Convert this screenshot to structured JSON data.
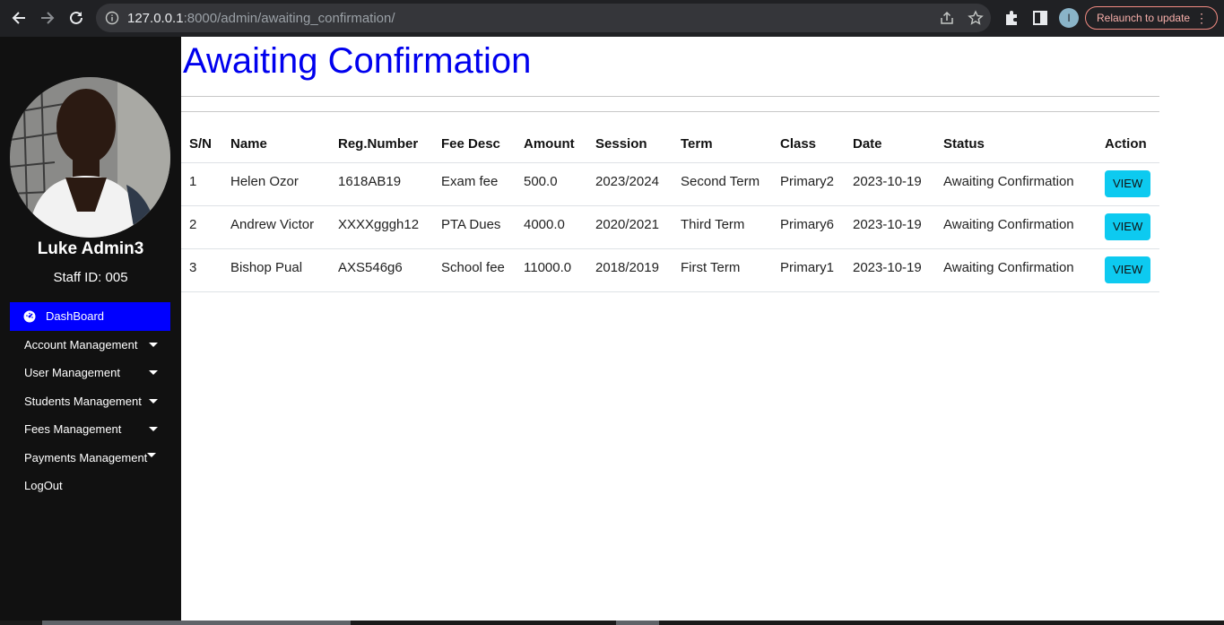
{
  "browser": {
    "url_host": "127.0.0.1",
    "url_rest": ":8000/admin/awaiting_confirmation/",
    "profile_initial": "I",
    "relaunch_label": "Relaunch to update"
  },
  "sidebar": {
    "user_name": "Luke Admin3",
    "staff_id": "Staff ID: 005",
    "items": [
      {
        "label": "DashBoard",
        "active": true
      },
      {
        "label": "Account Management",
        "has_caret": true
      },
      {
        "label": "User Management",
        "has_caret": true
      },
      {
        "label": "Students Management",
        "has_caret": true
      },
      {
        "label": "Fees Management",
        "has_caret": true
      },
      {
        "label": "Payments Management",
        "has_caret": true
      },
      {
        "label": "LogOut"
      }
    ]
  },
  "main": {
    "title": "Awaiting Confirmation",
    "columns": [
      "S/N",
      "Name",
      "Reg.Number",
      "Fee Desc",
      "Amount",
      "Session",
      "Term",
      "Class",
      "Date",
      "Status",
      "Action"
    ],
    "rows": [
      {
        "sn": "1",
        "name": "Helen Ozor",
        "reg": "1618AB19",
        "fee": "Exam fee",
        "amount": "500.0",
        "session": "2023/2024",
        "term": "Second Term",
        "class": "Primary2",
        "date": "2023-10-19",
        "status": "Awaiting Confirmation",
        "action": "VIEW"
      },
      {
        "sn": "2",
        "name": "Andrew Victor",
        "reg": "XXXXgggh12",
        "fee": "PTA Dues",
        "amount": "4000.0",
        "session": "2020/2021",
        "term": "Third Term",
        "class": "Primary6",
        "date": "2023-10-19",
        "status": "Awaiting Confirmation",
        "action": "VIEW"
      },
      {
        "sn": "3",
        "name": "Bishop Pual",
        "reg": "AXS546g6",
        "fee": "School fee",
        "amount": "11000.0",
        "session": "2018/2019",
        "term": "First Term",
        "class": "Primary1",
        "date": "2023-10-19",
        "status": "Awaiting Confirmation",
        "action": "VIEW"
      }
    ]
  },
  "colors": {
    "accent": "#0000ff",
    "title": "#0000ee",
    "view_button": "#0dcaf0",
    "sidebar_bg": "#111111"
  }
}
